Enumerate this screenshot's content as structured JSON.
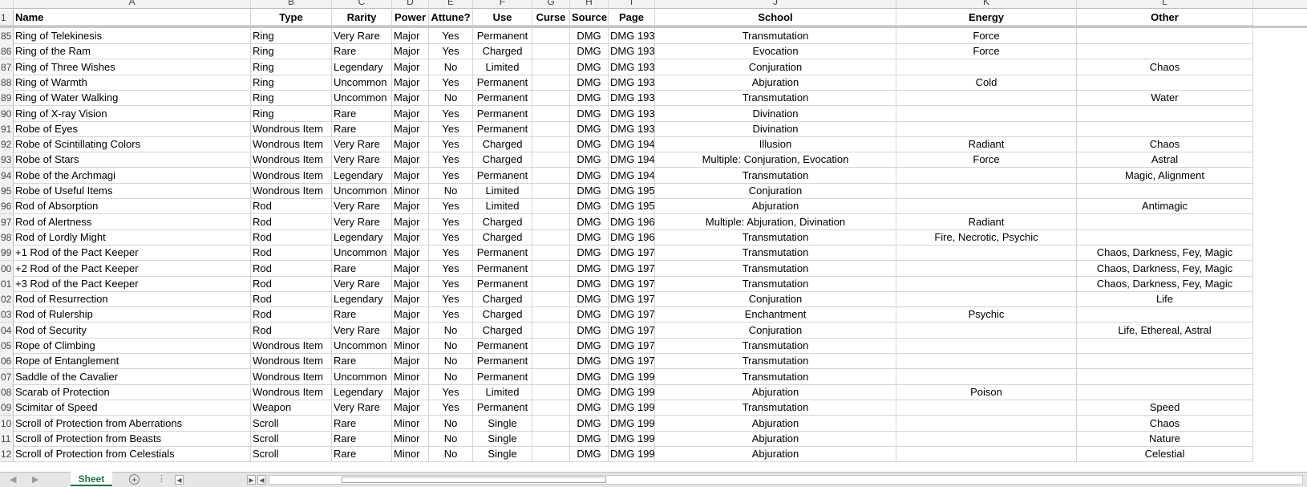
{
  "column_letters": [
    "A",
    "B",
    "C",
    "D",
    "E",
    "F",
    "G",
    "H",
    "I",
    "J",
    "K",
    "L"
  ],
  "header_row_number": "1",
  "headers": [
    "Name",
    "Type",
    "Rarity",
    "Power",
    "Attune?",
    "Use",
    "Curse",
    "Source",
    "Page",
    "School",
    "Energy",
    "Other"
  ],
  "rows": [
    {
      "n": "85",
      "cells": [
        "Ring of Telekinesis",
        "Ring",
        "Very Rare",
        "Major",
        "Yes",
        "Permanent",
        "",
        "DMG",
        "DMG 193",
        "Transmutation",
        "Force",
        ""
      ]
    },
    {
      "n": "86",
      "cells": [
        "Ring of the Ram",
        "Ring",
        "Rare",
        "Major",
        "Yes",
        "Charged",
        "",
        "DMG",
        "DMG 193",
        "Evocation",
        "Force",
        ""
      ]
    },
    {
      "n": "87",
      "cells": [
        "Ring of Three Wishes",
        "Ring",
        "Legendary",
        "Major",
        "No",
        "Limited",
        "",
        "DMG",
        "DMG 193",
        "Conjuration",
        "",
        "Chaos"
      ]
    },
    {
      "n": "88",
      "cells": [
        "Ring of Warmth",
        "Ring",
        "Uncommon",
        "Major",
        "Yes",
        "Permanent",
        "",
        "DMG",
        "DMG 193",
        "Abjuration",
        "Cold",
        ""
      ]
    },
    {
      "n": "89",
      "cells": [
        "Ring of Water Walking",
        "Ring",
        "Uncommon",
        "Major",
        "No",
        "Permanent",
        "",
        "DMG",
        "DMG 193",
        "Transmutation",
        "",
        "Water"
      ]
    },
    {
      "n": "90",
      "cells": [
        "Ring of X-ray Vision",
        "Ring",
        "Rare",
        "Major",
        "Yes",
        "Permanent",
        "",
        "DMG",
        "DMG 193",
        "Divination",
        "",
        ""
      ]
    },
    {
      "n": "91",
      "cells": [
        "Robe of Eyes",
        "Wondrous Item",
        "Rare",
        "Major",
        "Yes",
        "Permanent",
        "",
        "DMG",
        "DMG 193",
        "Divination",
        "",
        ""
      ]
    },
    {
      "n": "92",
      "cells": [
        "Robe of Scintillating Colors",
        "Wondrous Item",
        "Very Rare",
        "Major",
        "Yes",
        "Charged",
        "",
        "DMG",
        "DMG 194",
        "Illusion",
        "Radiant",
        "Chaos"
      ]
    },
    {
      "n": "93",
      "cells": [
        "Robe of Stars",
        "Wondrous Item",
        "Very Rare",
        "Major",
        "Yes",
        "Charged",
        "",
        "DMG",
        "DMG 194",
        "Multiple: Conjuration, Evocation",
        "Force",
        "Astral"
      ]
    },
    {
      "n": "94",
      "cells": [
        "Robe of the Archmagi",
        "Wondrous Item",
        "Legendary",
        "Major",
        "Yes",
        "Permanent",
        "",
        "DMG",
        "DMG 194",
        "Transmutation",
        "",
        "Magic, Alignment"
      ]
    },
    {
      "n": "95",
      "cells": [
        "Robe of Useful Items",
        "Wondrous Item",
        "Uncommon",
        "Minor",
        "No",
        "Limited",
        "",
        "DMG",
        "DMG 195",
        "Conjuration",
        "",
        ""
      ]
    },
    {
      "n": "96",
      "cells": [
        "Rod of Absorption",
        "Rod",
        "Very Rare",
        "Major",
        "Yes",
        "Limited",
        "",
        "DMG",
        "DMG 195",
        "Abjuration",
        "",
        "Antimagic"
      ]
    },
    {
      "n": "97",
      "cells": [
        "Rod of Alertness",
        "Rod",
        "Very Rare",
        "Major",
        "Yes",
        "Charged",
        "",
        "DMG",
        "DMG 196",
        "Multiple: Abjuration, Divination",
        "Radiant",
        ""
      ]
    },
    {
      "n": "98",
      "cells": [
        "Rod of Lordly Might",
        "Rod",
        "Legendary",
        "Major",
        "Yes",
        "Charged",
        "",
        "DMG",
        "DMG 196",
        "Transmutation",
        "Fire, Necrotic, Psychic",
        ""
      ]
    },
    {
      "n": "99",
      "cells": [
        "+1 Rod of the Pact Keeper",
        "Rod",
        "Uncommon",
        "Major",
        "Yes",
        "Permanent",
        "",
        "DMG",
        "DMG 197",
        "Transmutation",
        "",
        "Chaos, Darkness, Fey, Magic"
      ]
    },
    {
      "n": "00",
      "cells": [
        "+2 Rod of the Pact Keeper",
        "Rod",
        "Rare",
        "Major",
        "Yes",
        "Permanent",
        "",
        "DMG",
        "DMG 197",
        "Transmutation",
        "",
        "Chaos, Darkness, Fey, Magic"
      ]
    },
    {
      "n": "01",
      "cells": [
        "+3 Rod of the Pact Keeper",
        "Rod",
        "Very Rare",
        "Major",
        "Yes",
        "Permanent",
        "",
        "DMG",
        "DMG 197",
        "Transmutation",
        "",
        "Chaos, Darkness, Fey, Magic"
      ]
    },
    {
      "n": "02",
      "cells": [
        "Rod of Resurrection",
        "Rod",
        "Legendary",
        "Major",
        "Yes",
        "Charged",
        "",
        "DMG",
        "DMG 197",
        "Conjuration",
        "",
        "Life"
      ]
    },
    {
      "n": "03",
      "cells": [
        "Rod of Rulership",
        "Rod",
        "Rare",
        "Major",
        "Yes",
        "Charged",
        "",
        "DMG",
        "DMG 197",
        "Enchantment",
        "Psychic",
        ""
      ]
    },
    {
      "n": "04",
      "cells": [
        "Rod of Security",
        "Rod",
        "Very Rare",
        "Major",
        "No",
        "Charged",
        "",
        "DMG",
        "DMG 197",
        "Conjuration",
        "",
        "Life, Ethereal, Astral"
      ]
    },
    {
      "n": "05",
      "cells": [
        "Rope of Climbing",
        "Wondrous Item",
        "Uncommon",
        "Minor",
        "No",
        "Permanent",
        "",
        "DMG",
        "DMG 197",
        "Transmutation",
        "",
        ""
      ]
    },
    {
      "n": "06",
      "cells": [
        "Rope of Entanglement",
        "Wondrous Item",
        "Rare",
        "Major",
        "No",
        "Permanent",
        "",
        "DMG",
        "DMG 197",
        "Transmutation",
        "",
        ""
      ]
    },
    {
      "n": "07",
      "cells": [
        "Saddle of the Cavalier",
        "Wondrous Item",
        "Uncommon",
        "Minor",
        "No",
        "Permanent",
        "",
        "DMG",
        "DMG 199",
        "Transmutation",
        "",
        ""
      ]
    },
    {
      "n": "08",
      "cells": [
        "Scarab of Protection",
        "Wondrous Item",
        "Legendary",
        "Major",
        "Yes",
        "Limited",
        "",
        "DMG",
        "DMG 199",
        "Abjuration",
        "Poison",
        ""
      ]
    },
    {
      "n": "09",
      "cells": [
        "Scimitar of Speed",
        "Weapon",
        "Very Rare",
        "Major",
        "Yes",
        "Permanent",
        "",
        "DMG",
        "DMG 199",
        "Transmutation",
        "",
        "Speed"
      ]
    },
    {
      "n": "10",
      "cells": [
        "Scroll of Protection from Aberrations",
        "Scroll",
        "Rare",
        "Minor",
        "No",
        "Single",
        "",
        "DMG",
        "DMG 199",
        "Abjuration",
        "",
        "Chaos"
      ]
    },
    {
      "n": "11",
      "cells": [
        "Scroll of Protection from Beasts",
        "Scroll",
        "Rare",
        "Minor",
        "No",
        "Single",
        "",
        "DMG",
        "DMG 199",
        "Abjuration",
        "",
        "Nature"
      ]
    },
    {
      "n": "12",
      "cells": [
        "Scroll of Protection from Celestials",
        "Scroll",
        "Rare",
        "Minor",
        "No",
        "Single",
        "",
        "DMG",
        "DMG 199",
        "Abjuration",
        "",
        "Celestial"
      ]
    }
  ],
  "sheet_tab": "Sheet",
  "add_sheet_symbol": "+",
  "nav_prev_symbol": "◀",
  "nav_next_symbol": "▶",
  "scroll_left_symbol": "◀",
  "scroll_right_symbol": "▶",
  "options_symbol": "⋮",
  "colors": {
    "accent": "#217346",
    "grid": "#d4d4d4",
    "header_bg": "#f2f2f2"
  }
}
